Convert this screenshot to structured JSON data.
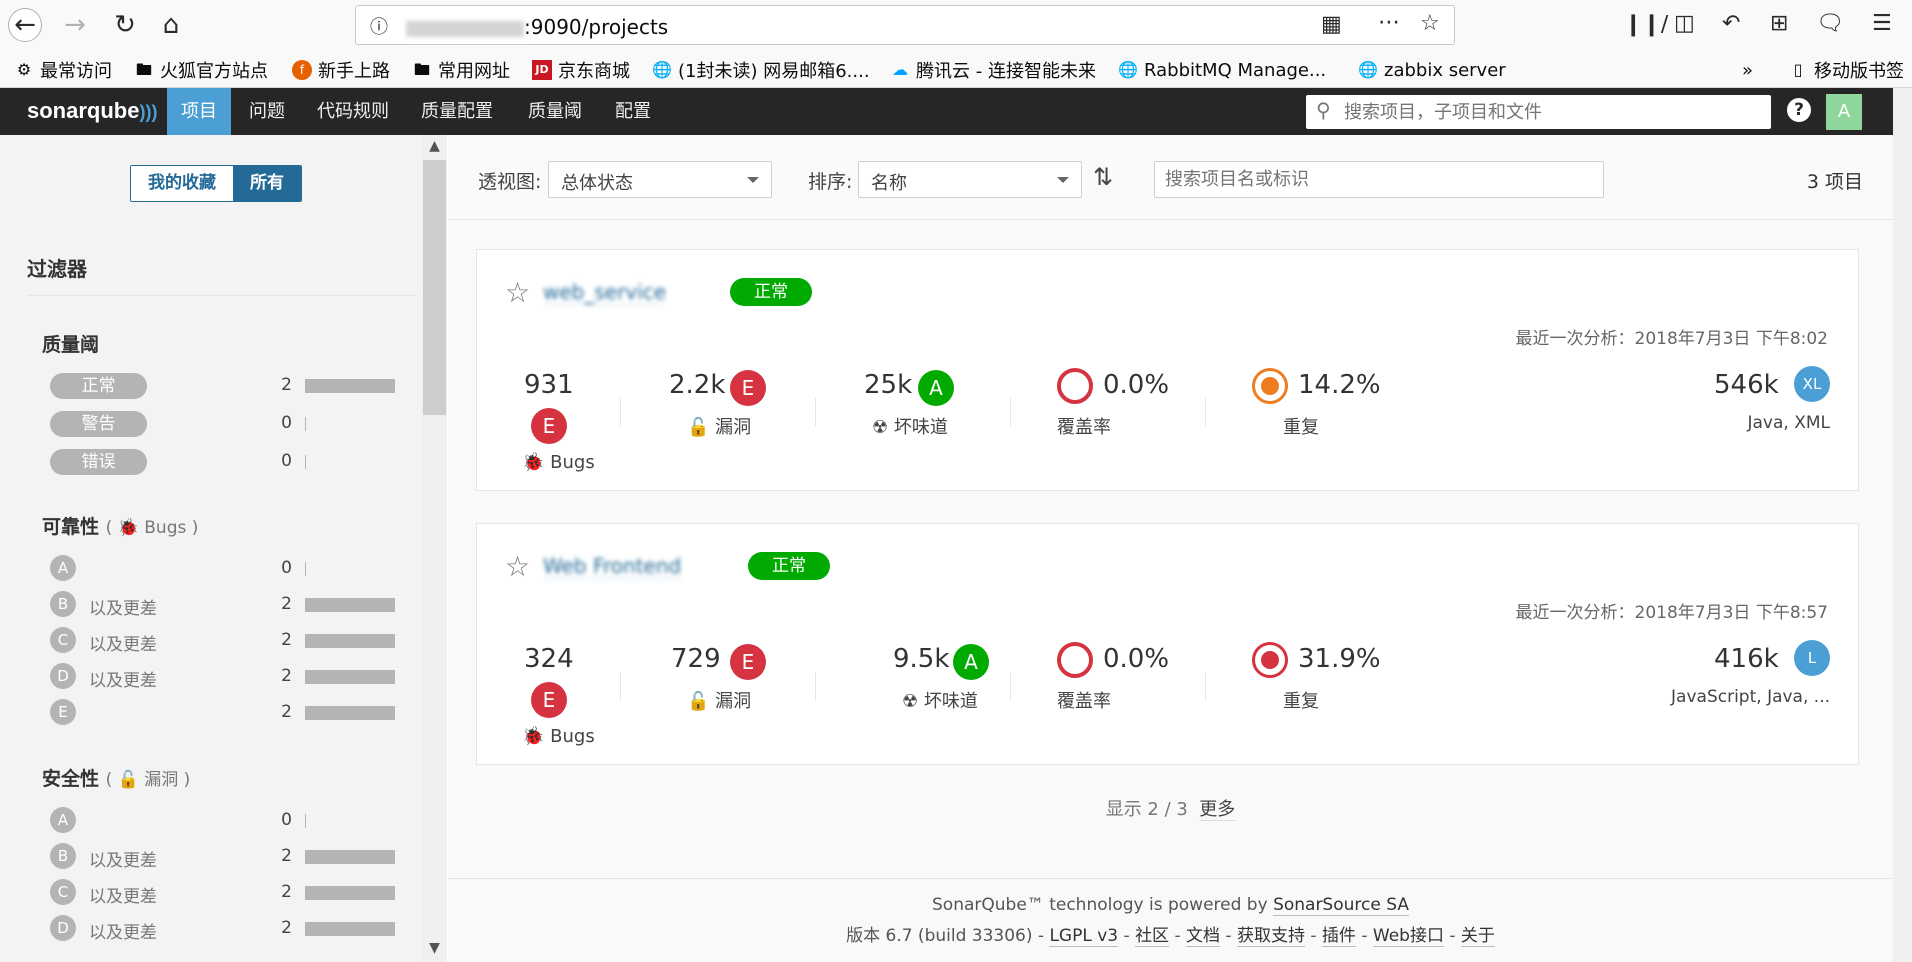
{
  "browser": {
    "url_suffix": ":9090/projects",
    "bookmarks": [
      {
        "label": "最常访问",
        "icon": "gear-icon"
      },
      {
        "label": "火狐官方站点",
        "icon": "folder-icon"
      },
      {
        "label": "新手上路",
        "icon": "firefox-icon"
      },
      {
        "label": "常用网址",
        "icon": "folder-icon"
      },
      {
        "label": "京东商城",
        "icon": "jd-icon"
      },
      {
        "label": "(1封未读) 网易邮箱6....",
        "icon": "globe-icon"
      },
      {
        "label": "腾讯云 - 连接智能未来",
        "icon": "cloud-icon"
      },
      {
        "label": "RabbitMQ Manage...",
        "icon": "globe-icon"
      },
      {
        "label": "zabbix server",
        "icon": "globe-icon"
      }
    ],
    "mobile_bookmarks": "移动版书签"
  },
  "sonar_nav": {
    "logo": "sonarqube",
    "items": [
      "项目",
      "问题",
      "代码规则",
      "质量配置",
      "质量阈",
      "配置"
    ],
    "search_placeholder": "搜索项目，子项目和文件",
    "help": "?",
    "avatar": "A"
  },
  "sidebar": {
    "toggle": {
      "favorites": "我的收藏",
      "all": "所有"
    },
    "filters_title": "过滤器",
    "quality_gate": {
      "title": "质量阈",
      "items": [
        {
          "label": "正常",
          "count": "2",
          "fraction": 1.0
        },
        {
          "label": "警告",
          "count": "0",
          "fraction": 0
        },
        {
          "label": "错误",
          "count": "0",
          "fraction": 0
        }
      ]
    },
    "reliability": {
      "title": "可靠性",
      "sub": "Bugs",
      "items": [
        {
          "letter": "A",
          "label": "",
          "count": "0",
          "fraction": 0
        },
        {
          "letter": "B",
          "label": "以及更差",
          "count": "2",
          "fraction": 1.0
        },
        {
          "letter": "C",
          "label": "以及更差",
          "count": "2",
          "fraction": 1.0
        },
        {
          "letter": "D",
          "label": "以及更差",
          "count": "2",
          "fraction": 1.0
        },
        {
          "letter": "E",
          "label": "",
          "count": "2",
          "fraction": 1.0
        }
      ]
    },
    "security": {
      "title": "安全性",
      "sub": "漏洞",
      "items": [
        {
          "letter": "A",
          "label": "",
          "count": "0",
          "fraction": 0
        },
        {
          "letter": "B",
          "label": "以及更差",
          "count": "2",
          "fraction": 1.0
        },
        {
          "letter": "C",
          "label": "以及更差",
          "count": "2",
          "fraction": 1.0
        },
        {
          "letter": "D",
          "label": "以及更差",
          "count": "2",
          "fraction": 1.0
        }
      ]
    }
  },
  "toolbar": {
    "view_label": "透视图:",
    "view_value": "总体状态",
    "sort_label": "排序:",
    "sort_value": "名称",
    "search_placeholder": "搜索项目名或标识",
    "count": "3 项目"
  },
  "projects": [
    {
      "name": "web_service",
      "status": "正常",
      "last_analysis": "最近一次分析：2018年7月3日 下午8:02",
      "bugs": "931",
      "bugs_rating": "E",
      "bugs_label": "Bugs",
      "vulns": "2.2k",
      "vulns_rating": "E",
      "vulns_label": "漏洞",
      "smells": "25k",
      "smells_rating": "A",
      "smells_label": "坏味道",
      "coverage": "0.0%",
      "coverage_label": "覆盖率",
      "dup": "14.2%",
      "dup_label": "重复",
      "size": "546k",
      "lang_code": "XL",
      "languages": "Java, XML"
    },
    {
      "name": "Web Frontend",
      "status": "正常",
      "last_analysis": "最近一次分析：2018年7月3日 下午8:57",
      "bugs": "324",
      "bugs_rating": "E",
      "bugs_label": "Bugs",
      "vulns": "729",
      "vulns_rating": "E",
      "vulns_label": "漏洞",
      "smells": "9.5k",
      "smells_rating": "A",
      "smells_label": "坏味道",
      "coverage": "0.0%",
      "coverage_label": "覆盖率",
      "dup": "31.9%",
      "dup_label": "重复",
      "size": "416k",
      "lang_code": "L",
      "languages": "JavaScript, Java, ..."
    }
  ],
  "pager": {
    "text": "显示 2 / 3",
    "more": "更多"
  },
  "footer": {
    "line1_pre": "SonarQube™ technology is powered by ",
    "line1_link": "SonarSource SA",
    "version": "版本 6.7 (build 33306)",
    "links": [
      "LGPL v3",
      "社区",
      "文档",
      "获取支持",
      "插件",
      "Web接口",
      "关于"
    ]
  },
  "colors": {
    "accent": "#4b9fd5",
    "ok": "#00aa00",
    "rating_e": "#d4333f",
    "rating_a": "#00aa00",
    "dup_orange": "#ed7d20"
  }
}
